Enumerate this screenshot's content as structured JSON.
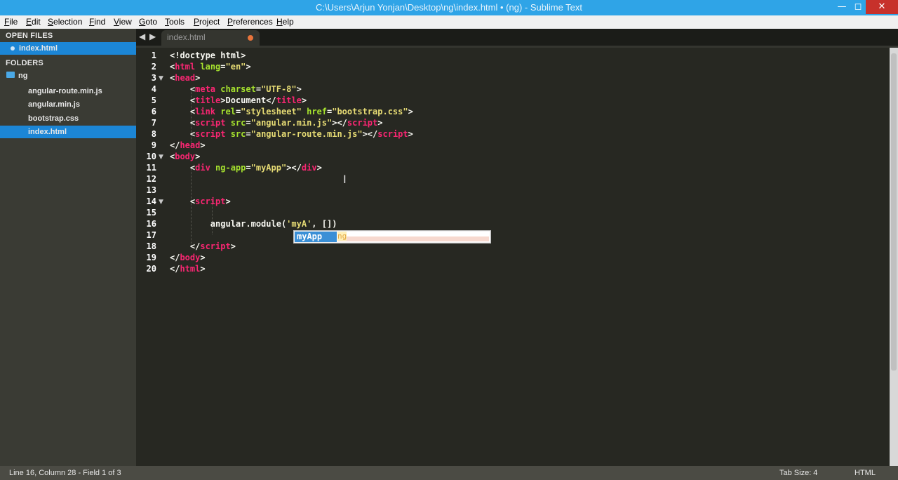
{
  "window": {
    "title": "C:\\Users\\Arjun Yonjan\\Desktop\\ng\\index.html • (ng) - Sublime Text",
    "minimize": "—",
    "maximize": "◻",
    "close": "✕"
  },
  "menu": [
    "File",
    "Edit",
    "Selection",
    "Find",
    "View",
    "Goto",
    "Tools",
    "Project",
    "Preferences",
    "Help"
  ],
  "sidebar": {
    "open_files_label": "OPEN FILES",
    "open_files": [
      "index.html"
    ],
    "folders_label": "FOLDERS",
    "folder": "ng",
    "files": [
      "angular-route.min.js",
      "angular.min.js",
      "bootstrap.css",
      "index.html"
    ],
    "selected_file": "index.html"
  },
  "tabs": [
    {
      "label": "index.html",
      "modified": true
    }
  ],
  "nav": {
    "back": "◀",
    "forward": "▶"
  },
  "editor": {
    "line_numbers": [
      "1",
      "2",
      "3",
      "4",
      "5",
      "6",
      "7",
      "8",
      "9",
      "10",
      "11",
      "12",
      "13",
      "14",
      "15",
      "16",
      "17",
      "18",
      "19",
      "20"
    ],
    "folded_lines": [
      3,
      10,
      14
    ],
    "lines": [
      [
        [
          "p",
          "<!doctype html>"
        ]
      ],
      [
        [
          "p",
          "<"
        ],
        [
          "t",
          "html"
        ],
        [
          "a",
          " lang"
        ],
        [
          "p",
          "="
        ],
        [
          "s",
          "\"en\""
        ],
        [
          "p",
          ">"
        ]
      ],
      [
        [
          "p",
          "<"
        ],
        [
          "t",
          "head"
        ],
        [
          "p",
          ">"
        ]
      ],
      [
        [
          "p",
          "    <"
        ],
        [
          "t",
          "meta"
        ],
        [
          "a",
          " charset"
        ],
        [
          "p",
          "="
        ],
        [
          "s",
          "\"UTF-8\""
        ],
        [
          "p",
          ">"
        ]
      ],
      [
        [
          "p",
          "    <"
        ],
        [
          "t",
          "title"
        ],
        [
          "p",
          ">Document</"
        ],
        [
          "t",
          "title"
        ],
        [
          "p",
          ">"
        ]
      ],
      [
        [
          "p",
          "    <"
        ],
        [
          "t",
          "link"
        ],
        [
          "a",
          " rel"
        ],
        [
          "p",
          "="
        ],
        [
          "s",
          "\"stylesheet\""
        ],
        [
          "a",
          " href"
        ],
        [
          "p",
          "="
        ],
        [
          "s",
          "\"bootstrap.css\""
        ],
        [
          "p",
          ">"
        ]
      ],
      [
        [
          "p",
          "    <"
        ],
        [
          "t",
          "script"
        ],
        [
          "a",
          " src"
        ],
        [
          "p",
          "="
        ],
        [
          "s",
          "\"angular.min.js\""
        ],
        [
          "p",
          "></"
        ],
        [
          "t",
          "script"
        ],
        [
          "p",
          ">"
        ]
      ],
      [
        [
          "p",
          "    <"
        ],
        [
          "t",
          "script"
        ],
        [
          "a",
          " src"
        ],
        [
          "p",
          "="
        ],
        [
          "s",
          "\"angular-route.min.js\""
        ],
        [
          "p",
          "></"
        ],
        [
          "t",
          "script"
        ],
        [
          "p",
          ">"
        ]
      ],
      [
        [
          "p",
          "</"
        ],
        [
          "t",
          "head"
        ],
        [
          "p",
          ">"
        ]
      ],
      [
        [
          "p",
          "<"
        ],
        [
          "t",
          "body"
        ],
        [
          "p",
          ">"
        ]
      ],
      [
        [
          "p",
          "    <"
        ],
        [
          "t",
          "div"
        ],
        [
          "a",
          " ng-app"
        ],
        [
          "p",
          "="
        ],
        [
          "s",
          "\"myApp\""
        ],
        [
          "p",
          "></"
        ],
        [
          "t",
          "div"
        ],
        [
          "p",
          ">"
        ]
      ],
      [
        [
          "p",
          ""
        ]
      ],
      [
        [
          "p",
          ""
        ]
      ],
      [
        [
          "p",
          "    <"
        ],
        [
          "t",
          "script"
        ],
        [
          "p",
          ">"
        ]
      ],
      [
        [
          "p",
          ""
        ]
      ],
      [
        [
          "p",
          "        angular.module("
        ],
        [
          "s",
          "'myA'"
        ],
        [
          "p",
          ", [])"
        ]
      ],
      [
        [
          "p",
          ""
        ]
      ],
      [
        [
          "p",
          "    </"
        ],
        [
          "t",
          "script"
        ],
        [
          "p",
          ">"
        ]
      ],
      [
        [
          "p",
          "</"
        ],
        [
          "t",
          "body"
        ],
        [
          "p",
          ">"
        ]
      ],
      [
        [
          "p",
          "</"
        ],
        [
          "t",
          "html"
        ],
        [
          "p",
          ">"
        ]
      ]
    ]
  },
  "autocomplete": {
    "selected": "myApp",
    "kind": "ng"
  },
  "status": {
    "left": "Line 16, Column 28 - Field 1 of 3",
    "tab_size": "Tab Size: 4",
    "syntax": "HTML"
  }
}
